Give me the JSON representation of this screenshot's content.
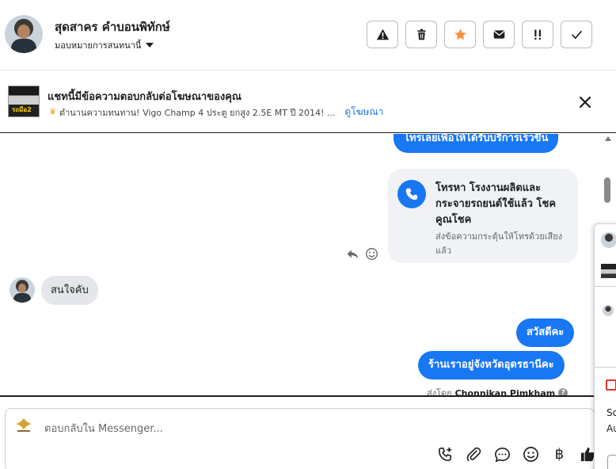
{
  "header": {
    "contact_name": "สุดสาคร คำบอนพิทักษ์",
    "assign_label": "มอบหมายการสนทนานี้",
    "actions": [
      {
        "icon": "warning-icon"
      },
      {
        "icon": "trash-icon"
      },
      {
        "icon": "star-icon",
        "color": "#f7923b"
      },
      {
        "icon": "mail-icon"
      },
      {
        "icon": "priority-icon"
      },
      {
        "icon": "check-icon"
      }
    ]
  },
  "ad_banner": {
    "title": "แชทนี้มีข้อความตอบกลับต่อโฆษณาของคุณ",
    "ad_text": "ตำนานความทนทาน! Vigo Champ 4 ประตู ยกสูง 2.5E MT ปี 2014! ...",
    "link": "ดูโฆษณา",
    "thumb_tag": "รถมือ2"
  },
  "messages": {
    "out_top": "โทรเลยเพื่อให้ได้รับบริการเร็วขึ้น",
    "call_card_title": "โทรหา โรงงานผลิตและกระจายรถยนต์ใช้แล้ว โชคคูณโชค",
    "call_card_sub": "ส่งข้อความกระตุ้นให้โทรด้วยเสียงแล้ว",
    "in_1": "สนใจคับ",
    "out_2": "สวัสดีคะ",
    "out_3": "ร้านเราอยู่จังหวัดอุดรธานีคะ",
    "sent_by_label": "ส่งโดย",
    "sent_by_name": "Chonnikan Pimkham"
  },
  "composer": {
    "placeholder": "ตอบกลับใน Messenger...",
    "tools": [
      "add-call-icon",
      "attachment-icon",
      "chat-icon",
      "emoji-icon",
      "baht-icon",
      "thumbs-up-icon"
    ],
    "baht_symbol": "฿"
  },
  "side_panel": {
    "text_1": "So",
    "text_2": "Au"
  },
  "colors": {
    "accent": "#1877f2",
    "bubble_in": "#e4e6eb",
    "card": "#f0f2f5"
  }
}
